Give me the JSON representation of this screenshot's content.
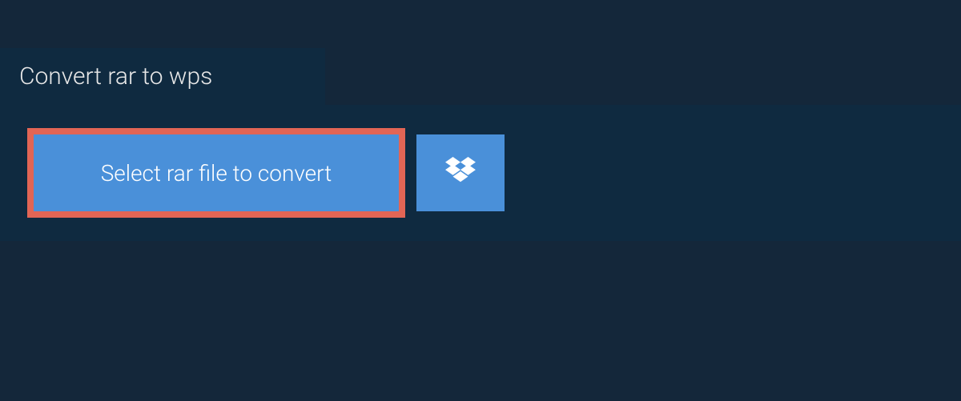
{
  "tab": {
    "title": "Convert rar to wps"
  },
  "actions": {
    "select_label": "Select rar file to convert"
  }
}
